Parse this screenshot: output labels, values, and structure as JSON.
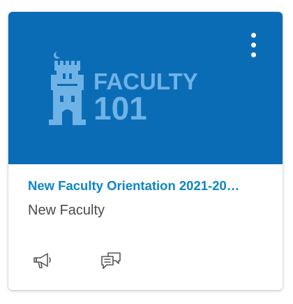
{
  "course": {
    "title": "New Faculty Orientation 2021-20…",
    "subtitle": "New Faculty",
    "image": {
      "line1": "FACULTY",
      "line2": "101",
      "background_color": "#0b6cb6",
      "logo_color": "#6fb2e6"
    },
    "title_color": "#0e85c6"
  },
  "icons": {
    "menu": "more-vertical-icon",
    "announcements": "megaphone-icon",
    "discussions": "discussions-icon"
  }
}
